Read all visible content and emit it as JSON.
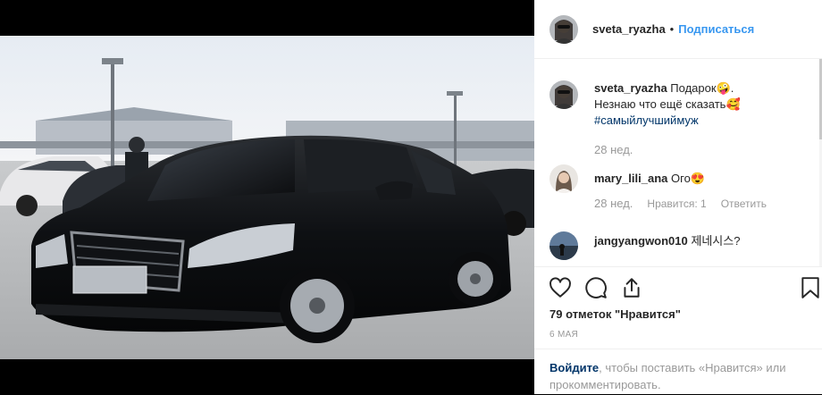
{
  "post": {
    "author": "sveta_ryazha",
    "follow_label": "Подписаться",
    "separator": "•"
  },
  "caption": {
    "username": "sveta_ryazha",
    "line1": "Подарок",
    "line1_emoji": "🤪",
    "line1_end": ".",
    "line2": "Незнаю что ещё сказать",
    "line2_emoji": "🥰",
    "hashtag": "#самыйлучшиймуж",
    "time": "28 нед."
  },
  "comments": [
    {
      "username": "mary_lili_ana",
      "text": "Ого",
      "emoji": "😍",
      "time": "28 нед.",
      "likes_label": "Нравится: 1",
      "reply_label": "Ответить"
    },
    {
      "username": "jangyangwon010",
      "text": "제네시스?"
    }
  ],
  "actions": {
    "like_icon": "heart-icon",
    "comment_icon": "comment-icon",
    "share_icon": "share-icon",
    "save_icon": "bookmark-icon"
  },
  "likes_text": "79 отметок \"Нравится\"",
  "date_text": "6 мая",
  "login": {
    "link": "Войдите",
    "rest": ", чтобы поставить «Нравится» или прокомментировать."
  },
  "colors": {
    "link_blue": "#3897f0",
    "hashtag": "#003569",
    "text": "#262626",
    "muted": "#999999"
  }
}
